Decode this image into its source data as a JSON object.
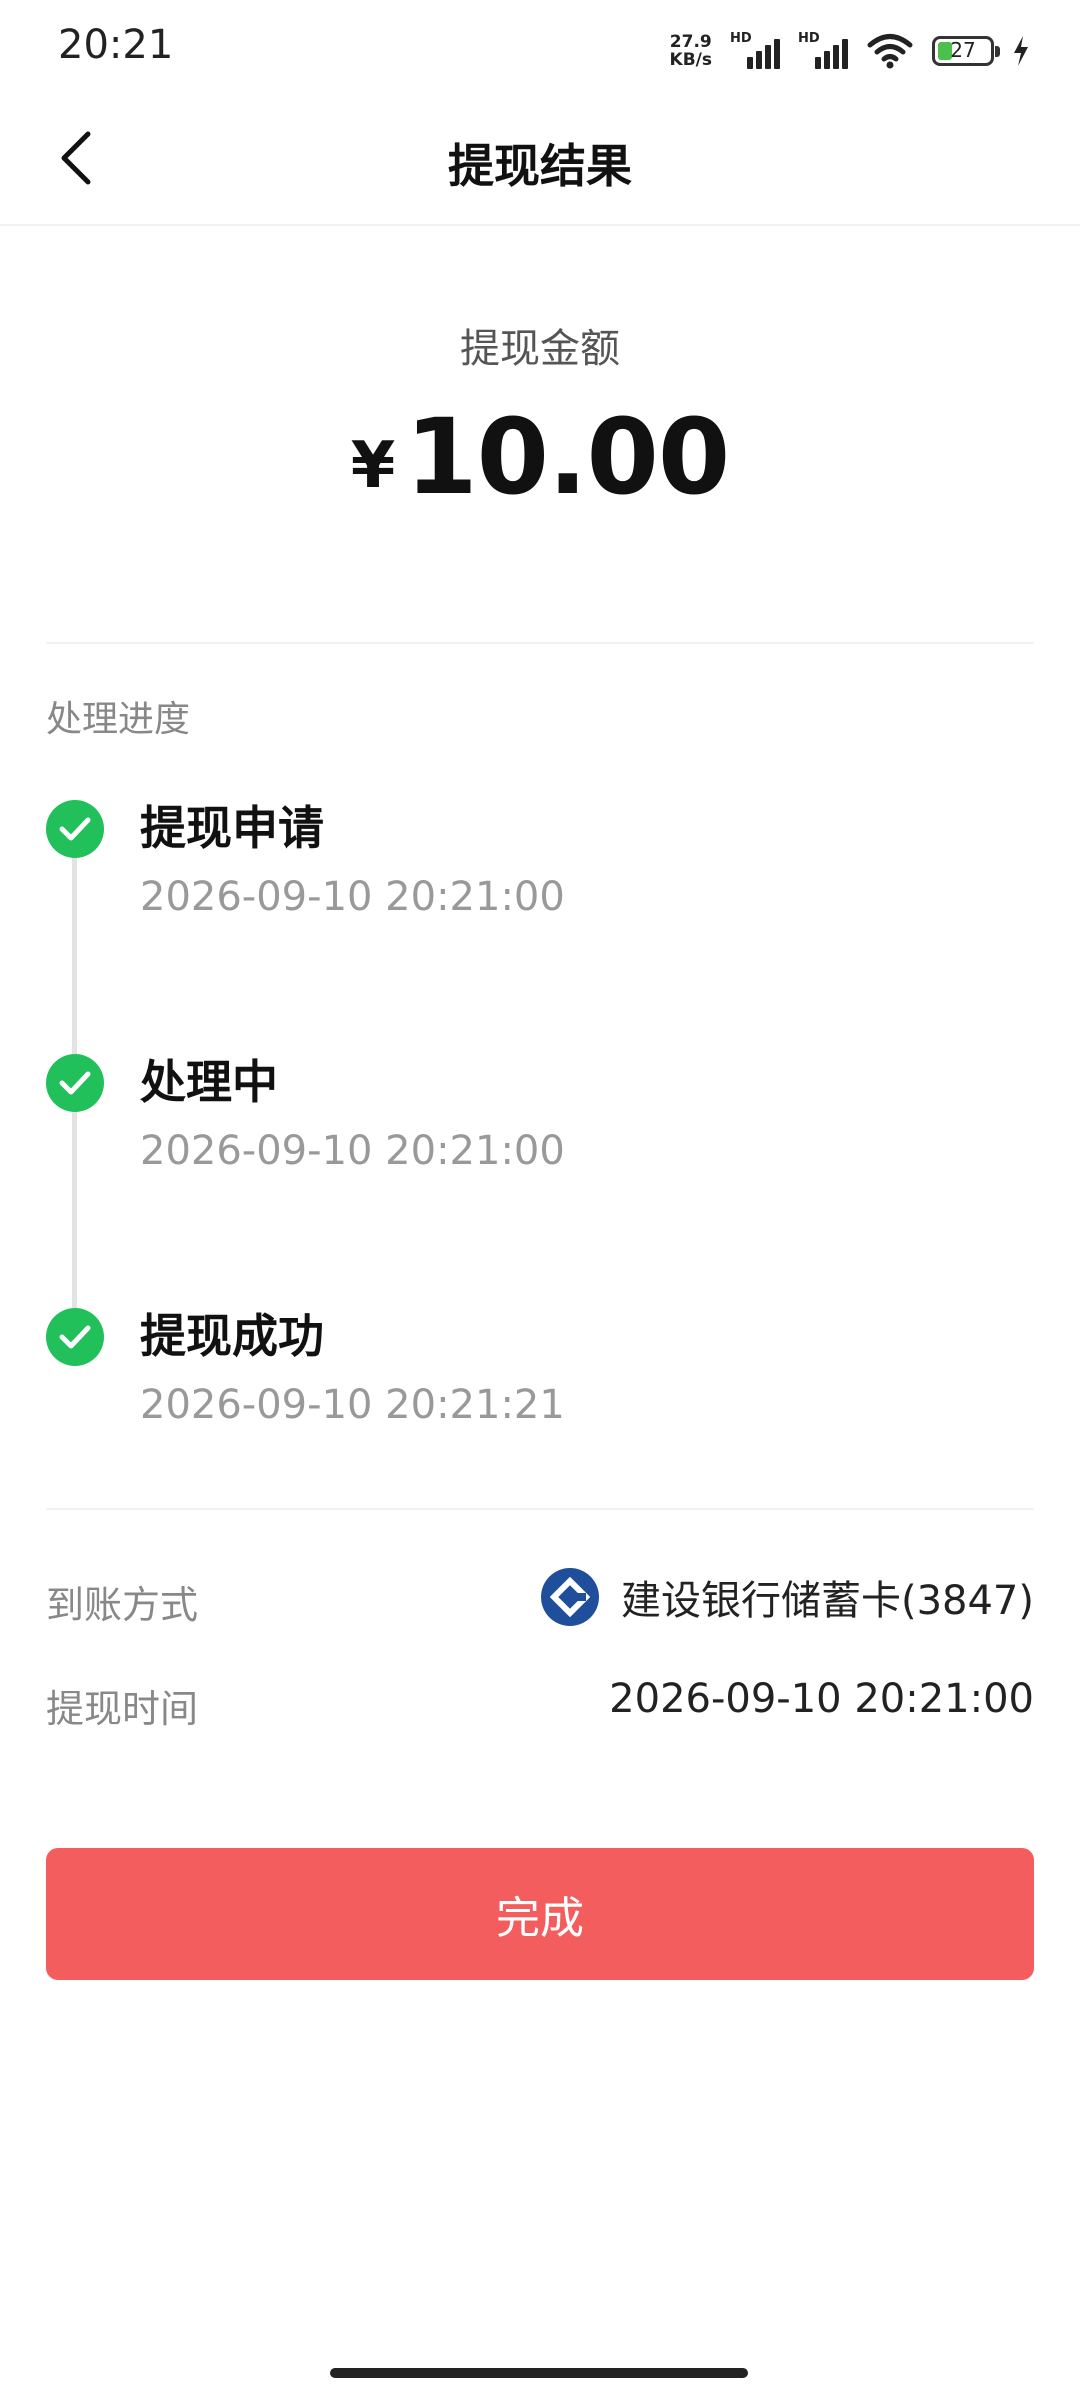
{
  "status_bar": {
    "time": "20:21",
    "net_speed_value": "27.9",
    "net_speed_unit": "KB/s",
    "sim1_label": "HD",
    "sim2_label": "HD",
    "battery_level": "27"
  },
  "nav": {
    "title": "提现结果",
    "back_icon": "chevron-left-icon"
  },
  "amount": {
    "label": "提现金额",
    "currency": "¥",
    "value": "10.00"
  },
  "progress": {
    "title": "处理进度",
    "steps": [
      {
        "title": "提现申请",
        "time": "2026-09-10 20:21:00",
        "status": "done"
      },
      {
        "title": "处理中",
        "time": "2026-09-10 20:21:00",
        "status": "done"
      },
      {
        "title": "提现成功",
        "time": "2026-09-10 20:21:21",
        "status": "done"
      }
    ]
  },
  "details": {
    "method_label": "到账方式",
    "method_value": "建设银行储蓄卡(3847)",
    "time_label": "提现时间",
    "time_value": "2026-09-10 20:21:00"
  },
  "actions": {
    "done_label": "完成"
  },
  "colors": {
    "success": "#21c05a",
    "primary_button": "#f45d5d",
    "bank_logo": "#1f4f9a"
  }
}
